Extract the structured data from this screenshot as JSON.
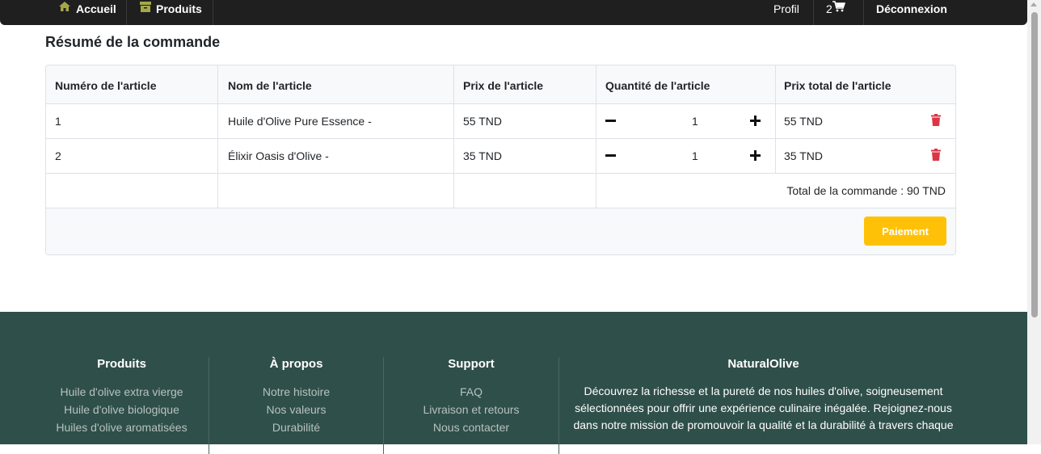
{
  "nav": {
    "home_label": "Accueil",
    "products_label": "Produits",
    "profile_label": "Profil",
    "cart_count": "2",
    "logout_label": "Déconnexion",
    "icon_color": "#a3a84a"
  },
  "order": {
    "title": "Résumé de la commande",
    "columns": [
      "Numéro de l'article",
      "Nom de l'article",
      "Prix de l'article",
      "Quantité de l'article",
      "Prix total de l'article"
    ],
    "items": [
      {
        "number": "1",
        "name": "Huile d'Olive Pure Essence -",
        "price": "55 TND",
        "quantity": "1",
        "total": "55 TND"
      },
      {
        "number": "2",
        "name": "Élixir Oasis d'Olive -",
        "price": "35 TND",
        "quantity": "1",
        "total": "35 TND"
      }
    ],
    "order_total": "Total de la commande : 90 TND",
    "pay_label": "Paiement"
  },
  "footer": {
    "products": {
      "heading": "Produits",
      "links": [
        "Huile d'olive extra vierge",
        "Huile d'olive biologique",
        "Huiles d'olive aromatisées"
      ]
    },
    "about": {
      "heading": "À propos",
      "links": [
        "Notre histoire",
        "Nos valeurs",
        "Durabilité"
      ]
    },
    "support": {
      "heading": "Support",
      "links": [
        "FAQ",
        "Livraison et retours",
        "Nous contacter"
      ]
    },
    "brand": {
      "heading": "NaturalOlive",
      "description": "Découvrez la richesse et la pureté de nos huiles d'olive, soigneusement sélectionnées pour offrir une expérience culinaire inégalée. Rejoignez-nous dans notre mission de promouvoir la qualité et la durabilité à travers chaque"
    }
  },
  "colors": {
    "navbar_bg": "#1f1f1f",
    "footer_bg": "#2f4f4a",
    "pay_button": "#ffc107",
    "delete_icon": "#dc3545"
  }
}
